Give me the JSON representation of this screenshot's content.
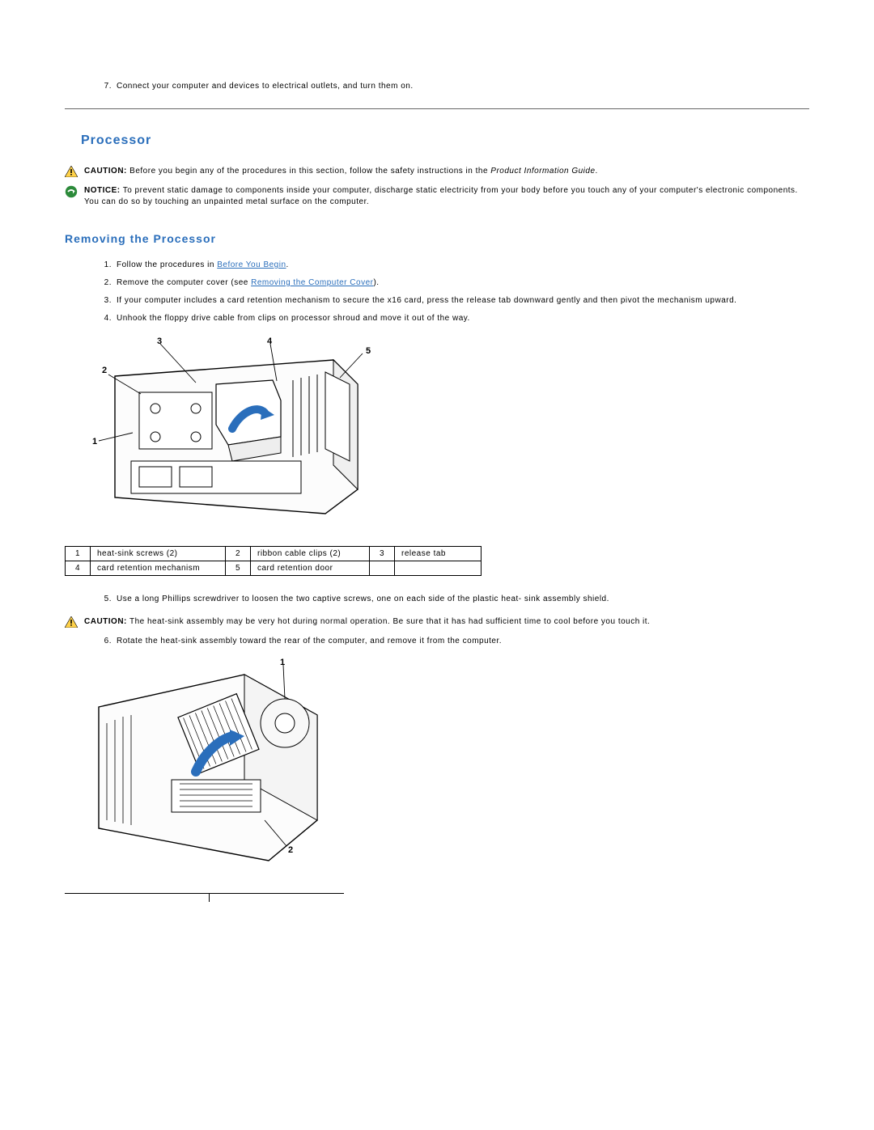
{
  "pre_step": {
    "num": "7.",
    "text": "Connect your computer and devices to electrical outlets, and turn them on."
  },
  "section": "Processor",
  "caution1": {
    "label": "CAUTION:",
    "text_before": " Before you begin any of the procedures in this section, follow the safety instructions in the ",
    "italic": "Product Information Guide",
    "after": "."
  },
  "notice1": {
    "label": "NOTICE:",
    "text": " To prevent static damage to components inside your computer, discharge static electricity from your body before you touch any of your computer's electronic components. You can do so by touching an unpainted metal surface on the computer."
  },
  "subsection": "Removing the Processor",
  "steps": [
    {
      "num": "1.",
      "text_before": "Follow the procedures in ",
      "link": "Before You Begin",
      "text_after": "."
    },
    {
      "num": "2.",
      "text_before": "Remove the computer cover (see ",
      "link": "Removing the Computer Cover",
      "text_after": ")."
    },
    {
      "num": "3.",
      "text": "If your computer includes a card retention mechanism to secure the x16 card, press the release tab downward gently and then pivot the mechanism upward."
    },
    {
      "num": "4.",
      "text": "Unhook the floppy drive cable from clips on processor shroud and move it out of the way."
    }
  ],
  "legend1": {
    "r1c1n": "1",
    "r1c1": "heat-sink screws (2)",
    "r1c2n": "2",
    "r1c2": "ribbon cable clips (2)",
    "r1c3n": "3",
    "r1c3": "release tab",
    "r2c1n": "4",
    "r2c1": "card retention mechanism",
    "r2c2n": "5",
    "r2c2": "card retention door",
    "r2c3n": "",
    "r2c3": ""
  },
  "step5": {
    "num": "5.",
    "text": "Use a long Phillips screwdriver to loosen the two captive screws, one on each side of the plastic heat- sink assembly shield."
  },
  "caution2": {
    "label": "CAUTION:",
    "text": " The heat-sink assembly may be very hot during normal operation. Be sure that it has had sufficient time to cool before you touch it."
  },
  "step6": {
    "num": "6.",
    "text": "Rotate the heat-sink assembly toward the rear of the computer, and remove it from the computer."
  },
  "fig1": {
    "l1": "1",
    "l2": "2",
    "l3": "3",
    "l4": "4",
    "l5": "5"
  },
  "fig2": {
    "l1": "1",
    "l2": "2"
  }
}
